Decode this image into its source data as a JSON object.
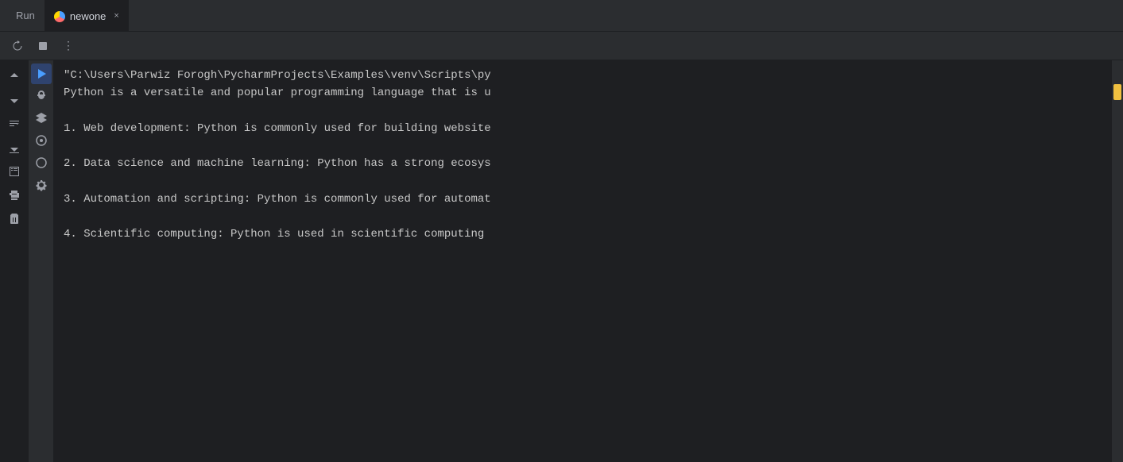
{
  "tabs": {
    "run_label": "Run",
    "active_tab_label": "newone",
    "close_symbol": "×"
  },
  "toolbar": {
    "rerun_title": "Rerun",
    "stop_title": "Stop",
    "more_title": "More options"
  },
  "left_sidebar": {
    "icons": [
      {
        "name": "scroll-up",
        "symbol": "↑"
      },
      {
        "name": "scroll-down",
        "symbol": "↓"
      },
      {
        "name": "soft-wrap",
        "symbol": "⇌"
      },
      {
        "name": "scroll-to-end",
        "symbol": "⤓"
      },
      {
        "name": "console",
        "symbol": "▶"
      },
      {
        "name": "print",
        "symbol": "🖨"
      },
      {
        "name": "clear",
        "symbol": "🗑"
      }
    ]
  },
  "action_sidebar": {
    "icons": [
      {
        "name": "run-active",
        "symbol": "▶"
      },
      {
        "name": "bug",
        "symbol": "🐛"
      },
      {
        "name": "layers",
        "symbol": "⊞"
      },
      {
        "name": "profile",
        "symbol": "◎"
      },
      {
        "name": "error",
        "symbol": "⊙"
      },
      {
        "name": "settings",
        "symbol": "✱"
      }
    ]
  },
  "console": {
    "lines": [
      "\"C:\\Users\\Parwiz Forogh\\PycharmProjects\\Examples\\venv\\Scripts\\py",
      "Python is a versatile and popular programming language that is u",
      "",
      "1. Web development: Python is commonly used for building website",
      "",
      "2. Data science and machine learning: Python has a strong ecosys",
      "",
      "3. Automation and scripting: Python is commonly used for automat",
      "",
      "4. Scientific computing: Python is used in scientific computing"
    ]
  }
}
